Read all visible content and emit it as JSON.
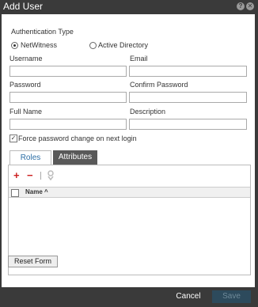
{
  "dialog": {
    "title": "Add User"
  },
  "auth": {
    "label": "Authentication Type",
    "options": [
      {
        "label": "NetWitness",
        "selected": true
      },
      {
        "label": "Active Directory",
        "selected": false
      }
    ]
  },
  "form": {
    "username_label": "Username",
    "username_value": "",
    "email_label": "Email",
    "email_value": "",
    "password_label": "Password",
    "password_value": "",
    "confirm_password_label": "Confirm Password",
    "confirm_password_value": "",
    "full_name_label": "Full Name",
    "full_name_value": "",
    "description_label": "Description",
    "description_value": "",
    "force_change_label": "Force password change on next login",
    "force_change_checked": true
  },
  "tabs": [
    {
      "label": "Roles",
      "active": true
    },
    {
      "label": "Attributes",
      "active": false
    }
  ],
  "roles_grid": {
    "columns": [
      {
        "label": "Name",
        "sort": "asc"
      }
    ],
    "rows": []
  },
  "buttons": {
    "reset": "Reset Form",
    "cancel": "Cancel",
    "save": "Save"
  },
  "colors": {
    "add_icon": "#cc1f1f",
    "remove_icon": "#cc1f1f",
    "active_tab_text": "#2c6ea5"
  }
}
